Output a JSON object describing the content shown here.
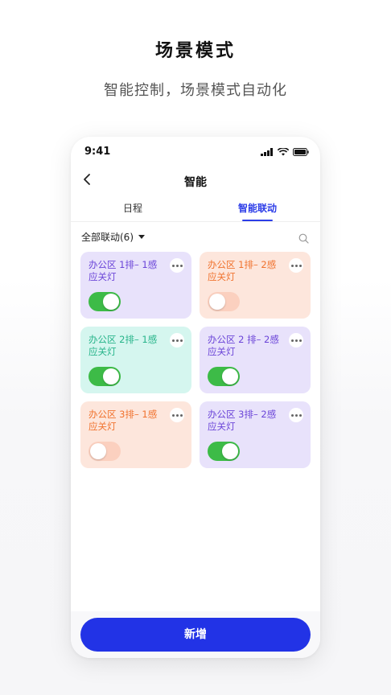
{
  "hero": {
    "title": "场景模式",
    "subtitle": "智能控制，场景模式自动化"
  },
  "status_bar": {
    "time": "9:41",
    "icons": [
      "signal-icon",
      "wifi-icon",
      "battery-icon"
    ]
  },
  "nav": {
    "back_icon": "chevron-left-icon",
    "title": "智能"
  },
  "tabs": [
    {
      "label": "日程",
      "active": false
    },
    {
      "label": "智能联动",
      "active": true
    }
  ],
  "filter": {
    "label": "全部联动(6)",
    "search_icon": "search-icon"
  },
  "cards": [
    {
      "line1": "办公区 1排– 1感",
      "line2": "应关灯",
      "on": true,
      "theme": "purple"
    },
    {
      "line1": "办公区 1排– 2感",
      "line2": "应关灯",
      "on": false,
      "theme": "orange"
    },
    {
      "line1": "办公区 2排– 1感",
      "line2": "应关灯",
      "on": true,
      "theme": "teal"
    },
    {
      "line1": "办公区 2 排– 2感",
      "line2": "应关灯",
      "on": true,
      "theme": "purple"
    },
    {
      "line1": "办公区 3排– 1感",
      "line2": "应关灯",
      "on": false,
      "theme": "orange"
    },
    {
      "line1": "办公区 3排– 2感",
      "line2": "应关灯",
      "on": true,
      "theme": "purple"
    }
  ],
  "primary_button": {
    "label": "新增"
  },
  "colors": {
    "accent": "#2233e6",
    "toggle_on": "#3dbb47",
    "purple_card": "#e8e2fb",
    "orange_card": "#fde6dc",
    "teal_card": "#d5f6ef"
  }
}
